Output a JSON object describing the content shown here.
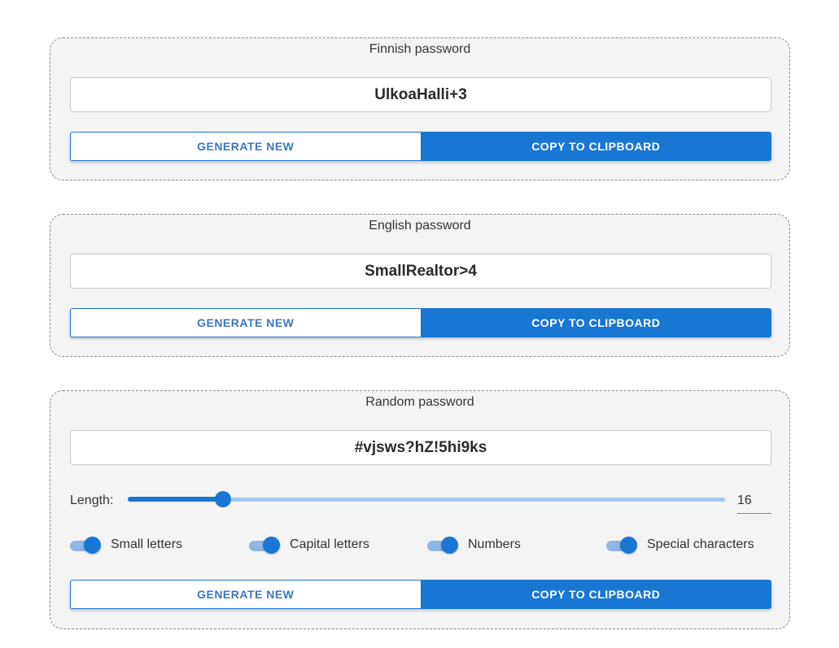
{
  "panels": [
    {
      "title": "Finnish password",
      "password": "UlkoaHalli+3",
      "generate_label": "GENERATE NEW",
      "copy_label": "COPY TO CLIPBOARD"
    },
    {
      "title": "English password",
      "password": "SmallRealtor>4",
      "generate_label": "GENERATE NEW",
      "copy_label": "COPY TO CLIPBOARD"
    },
    {
      "title": "Random password",
      "password": "#vjsws?hZ!5hi9ks",
      "length_label": "Length:",
      "length_value": "16",
      "slider_fraction": 0.16,
      "options": [
        {
          "label": "Small letters",
          "checked": true
        },
        {
          "label": "Capital letters",
          "checked": true
        },
        {
          "label": "Numbers",
          "checked": true
        },
        {
          "label": "Special characters",
          "checked": true
        }
      ],
      "generate_label": "GENERATE NEW",
      "copy_label": "COPY TO CLIPBOARD"
    }
  ],
  "colors": {
    "primary": "#1976d2",
    "panel_bg": "#f4f4f4",
    "rail": "#a7c8ec"
  }
}
